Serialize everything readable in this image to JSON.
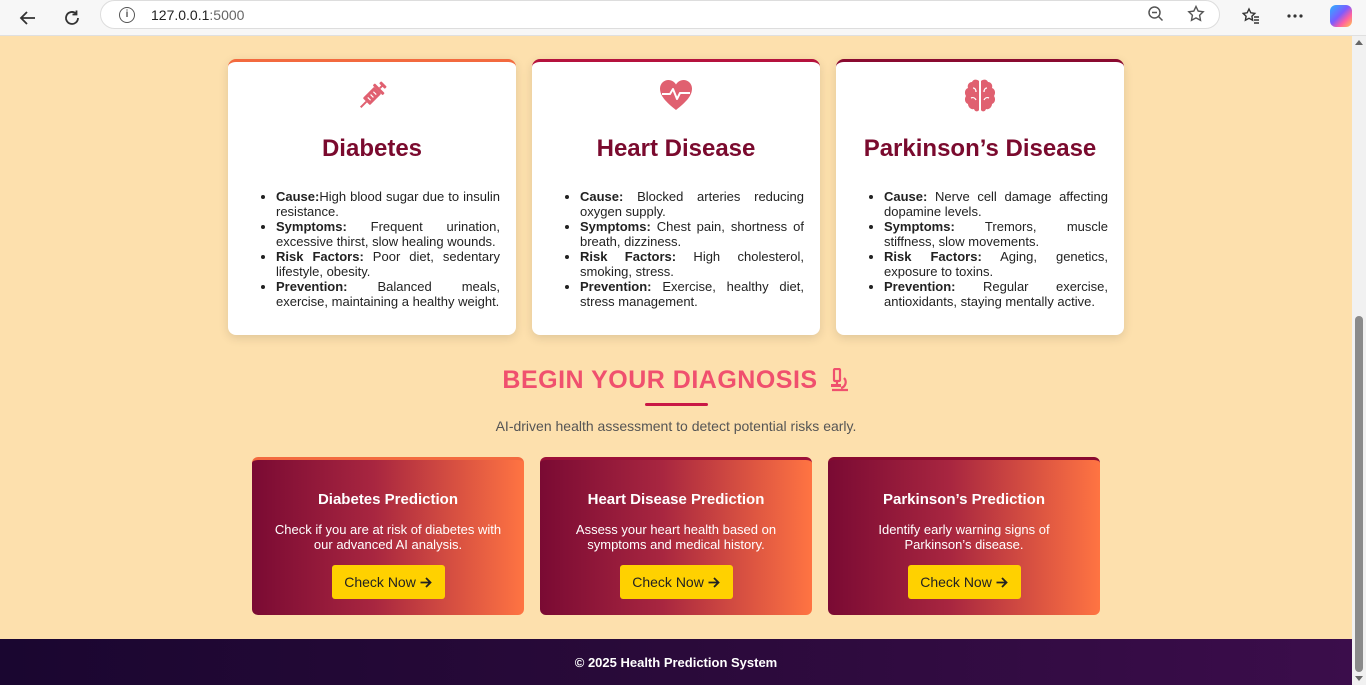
{
  "browser": {
    "url_host": "127.0.0.1",
    "url_port": ":5000"
  },
  "info_cards": [
    {
      "title": "Diabetes",
      "icon": "syringe-icon",
      "items": [
        {
          "label": "Cause:",
          "text": "High blood sugar due to insulin resistance."
        },
        {
          "label": "Symptoms:",
          "text": " Frequent urination, excessive thirst, slow healing wounds."
        },
        {
          "label": "Risk Factors:",
          "text": " Poor diet, sedentary lifestyle, obesity."
        },
        {
          "label": "Prevention:",
          "text": " Balanced meals, exercise, maintaining a healthy weight."
        }
      ]
    },
    {
      "title": "Heart Disease",
      "icon": "heartbeat-icon",
      "items": [
        {
          "label": "Cause:",
          "text": " Blocked arteries reducing oxygen supply."
        },
        {
          "label": "Symptoms:",
          "text": " Chest pain, shortness of breath, dizziness."
        },
        {
          "label": "Risk Factors:",
          "text": " High cholesterol, smoking, stress."
        },
        {
          "label": "Prevention:",
          "text": " Exercise, healthy diet, stress management."
        }
      ]
    },
    {
      "title": "Parkinson’s Disease",
      "icon": "brain-icon",
      "items": [
        {
          "label": "Cause:",
          "text": " Nerve cell damage affecting dopamine levels."
        },
        {
          "label": "Symptoms:",
          "text": " Tremors, muscle stiffness, slow movements."
        },
        {
          "label": "Risk Factors:",
          "text": " Aging, genetics, exposure to toxins."
        },
        {
          "label": "Prevention:",
          "text": " Regular exercise, antioxidants, staying mentally active."
        }
      ]
    }
  ],
  "diagnosis": {
    "title": "BEGIN YOUR DIAGNOSIS",
    "subtitle": "AI-driven health assessment to detect potential risks early."
  },
  "prediction_cards": [
    {
      "title": "Diabetes Prediction",
      "description": "Check if you are at risk of diabetes with our advanced AI analysis.",
      "button": "Check Now"
    },
    {
      "title": "Heart Disease Prediction",
      "description": "Assess your heart health based on symptoms and medical history.",
      "button": "Check Now"
    },
    {
      "title": "Parkinson’s Prediction",
      "description": "Identify early warning signs of Parkinson’s disease.",
      "button": "Check Now"
    }
  ],
  "footer": {
    "text": "© 2025 Health Prediction System"
  },
  "colors": {
    "background": "#fde0ad",
    "heading": "#7a0a2e",
    "accent": "#f0506e",
    "button": "#ffd100",
    "icon": "#e06070"
  }
}
